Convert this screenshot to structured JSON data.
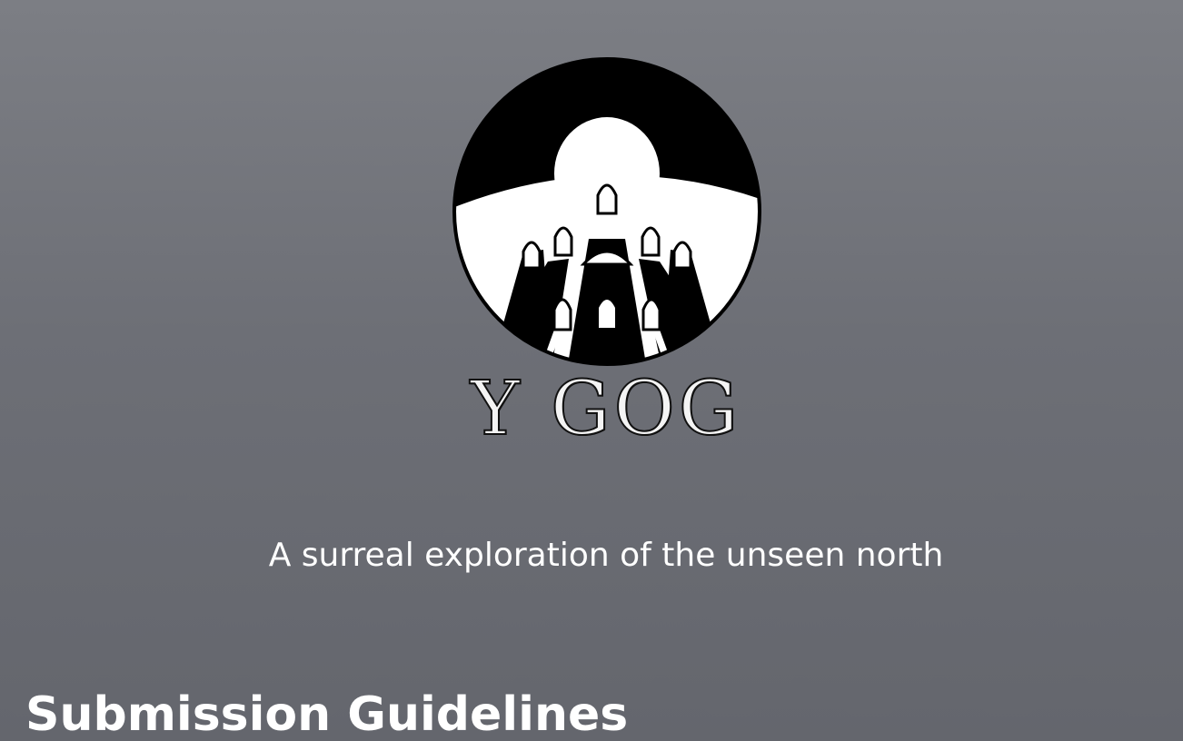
{
  "brand": {
    "logo_icon": "castle-moon-emblem-icon",
    "wordmark": "Y GOG",
    "tagline": "A surreal exploration of the unseen north"
  },
  "main": {
    "section_heading": "Submission Guidelines"
  },
  "colors": {
    "background_top": "#7c7e84",
    "background_bottom": "#64666d",
    "text": "#ffffff",
    "emblem_dark": "#000000",
    "emblem_light": "#ffffff"
  }
}
